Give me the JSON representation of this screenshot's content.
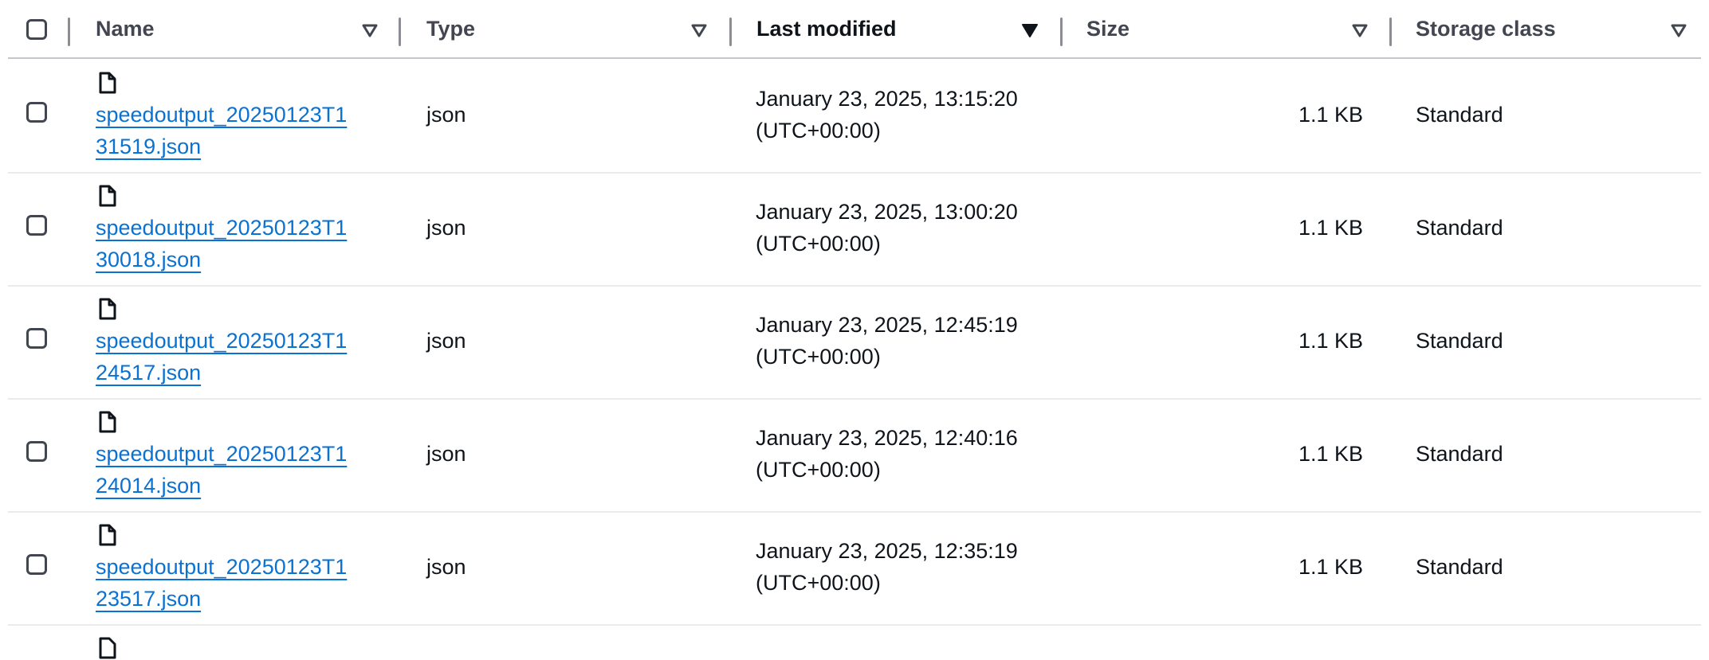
{
  "columns": {
    "name": "Name",
    "type": "Type",
    "last_modified": "Last modified",
    "size": "Size",
    "storage_class": "Storage class"
  },
  "sort_state": {
    "active_column": "last_modified",
    "direction": "descending"
  },
  "icons": {
    "file": "file-icon",
    "sort": "sort-caret-icon"
  },
  "colors": {
    "link": "#0972d3",
    "header_text": "#424650",
    "border": "#c6c6cd"
  },
  "rows": [
    {
      "name_line1": "speedoutput_20250123T1",
      "name_line2": "31519.json",
      "type": "json",
      "modified_line1": "January 23, 2025, 13:15:20",
      "modified_line2": "(UTC+00:00)",
      "size": "1.1 KB",
      "storage_class": "Standard"
    },
    {
      "name_line1": "speedoutput_20250123T1",
      "name_line2": "30018.json",
      "type": "json",
      "modified_line1": "January 23, 2025, 13:00:20",
      "modified_line2": "(UTC+00:00)",
      "size": "1.1 KB",
      "storage_class": "Standard"
    },
    {
      "name_line1": "speedoutput_20250123T1",
      "name_line2": "24517.json",
      "type": "json",
      "modified_line1": "January 23, 2025, 12:45:19",
      "modified_line2": "(UTC+00:00)",
      "size": "1.1 KB",
      "storage_class": "Standard"
    },
    {
      "name_line1": "speedoutput_20250123T1",
      "name_line2": "24014.json",
      "type": "json",
      "modified_line1": "January 23, 2025, 12:40:16",
      "modified_line2": "(UTC+00:00)",
      "size": "1.1 KB",
      "storage_class": "Standard"
    },
    {
      "name_line1": "speedoutput_20250123T1",
      "name_line2": "23517.json",
      "type": "json",
      "modified_line1": "January 23, 2025, 12:35:19",
      "modified_line2": "(UTC+00:00)",
      "size": "1.1 KB",
      "storage_class": "Standard"
    }
  ]
}
